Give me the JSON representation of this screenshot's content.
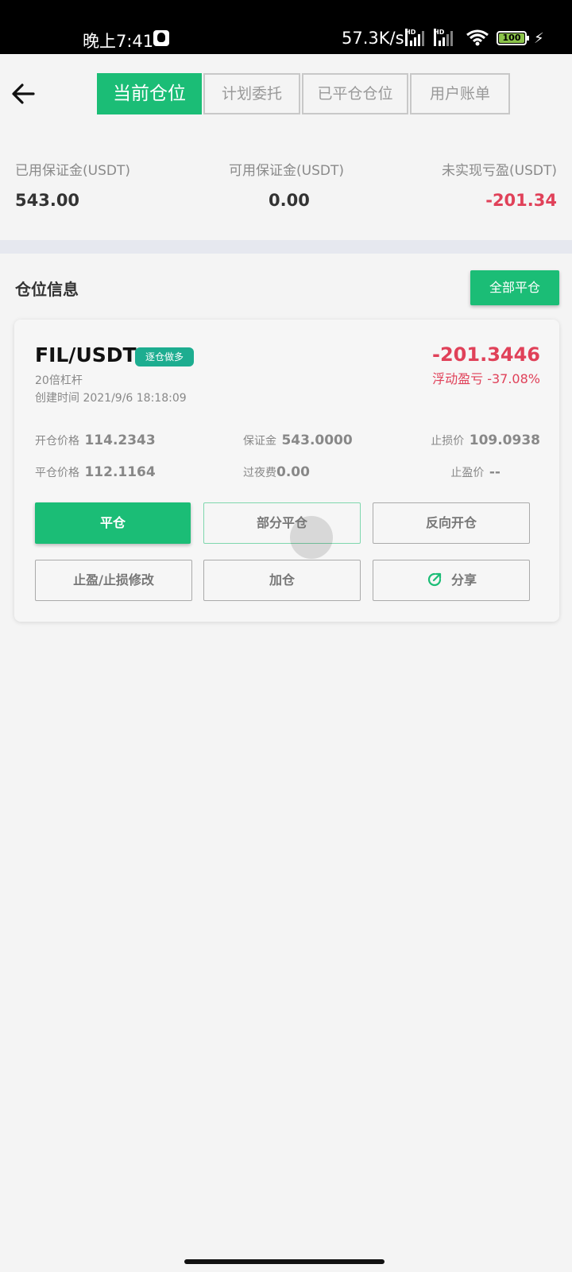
{
  "status_bar": {
    "time": "晚上7:41",
    "net_speed": "57.3K/s",
    "battery": "100"
  },
  "tabs": [
    {
      "label": "当前仓位",
      "active": true
    },
    {
      "label": "计划委托",
      "active": false
    },
    {
      "label": "已平仓仓位",
      "active": false
    },
    {
      "label": "用户账单",
      "active": false
    }
  ],
  "summary": {
    "used_margin_label": "已用保证金(USDT)",
    "used_margin_value": "543.00",
    "available_margin_label": "可用保证金(USDT)",
    "available_margin_value": "0.00",
    "unrealized_pnl_label": "未实现亏盈(USDT)",
    "unrealized_pnl_value": "-201.34"
  },
  "section": {
    "title": "仓位信息",
    "close_all_label": "全部平仓"
  },
  "position": {
    "pair": "FIL/USDT",
    "badge": "逐仓做多",
    "leverage": "20倍杠杆",
    "created": "创建时间 2021/9/6 18:18:09",
    "pnl": "-201.3446",
    "pnl_label": "浮动盈亏 -37.08%",
    "open_price_label": "开仓价格",
    "open_price": "114.2343",
    "margin_label": "保证金",
    "margin": "543.0000",
    "stop_loss_label": "止损价",
    "stop_loss": "109.0938",
    "close_price_label": "平仓价格",
    "close_price": "112.1164",
    "overnight_fee_label": "过夜费",
    "overnight_fee": "0.00",
    "take_profit_label": "止盈价",
    "take_profit": "--"
  },
  "buttons": {
    "close": "平仓",
    "partial_close": "部分平仓",
    "reverse_open": "反向开仓",
    "tp_sl_modify": "止盈/止损修改",
    "add": "加仓",
    "share": "分享"
  },
  "colors": {
    "accent": "#1bbd76",
    "loss": "#e04159",
    "badge": "#1dad90"
  },
  "icons": {
    "back": "arrow-left-icon",
    "share": "share-icon"
  }
}
